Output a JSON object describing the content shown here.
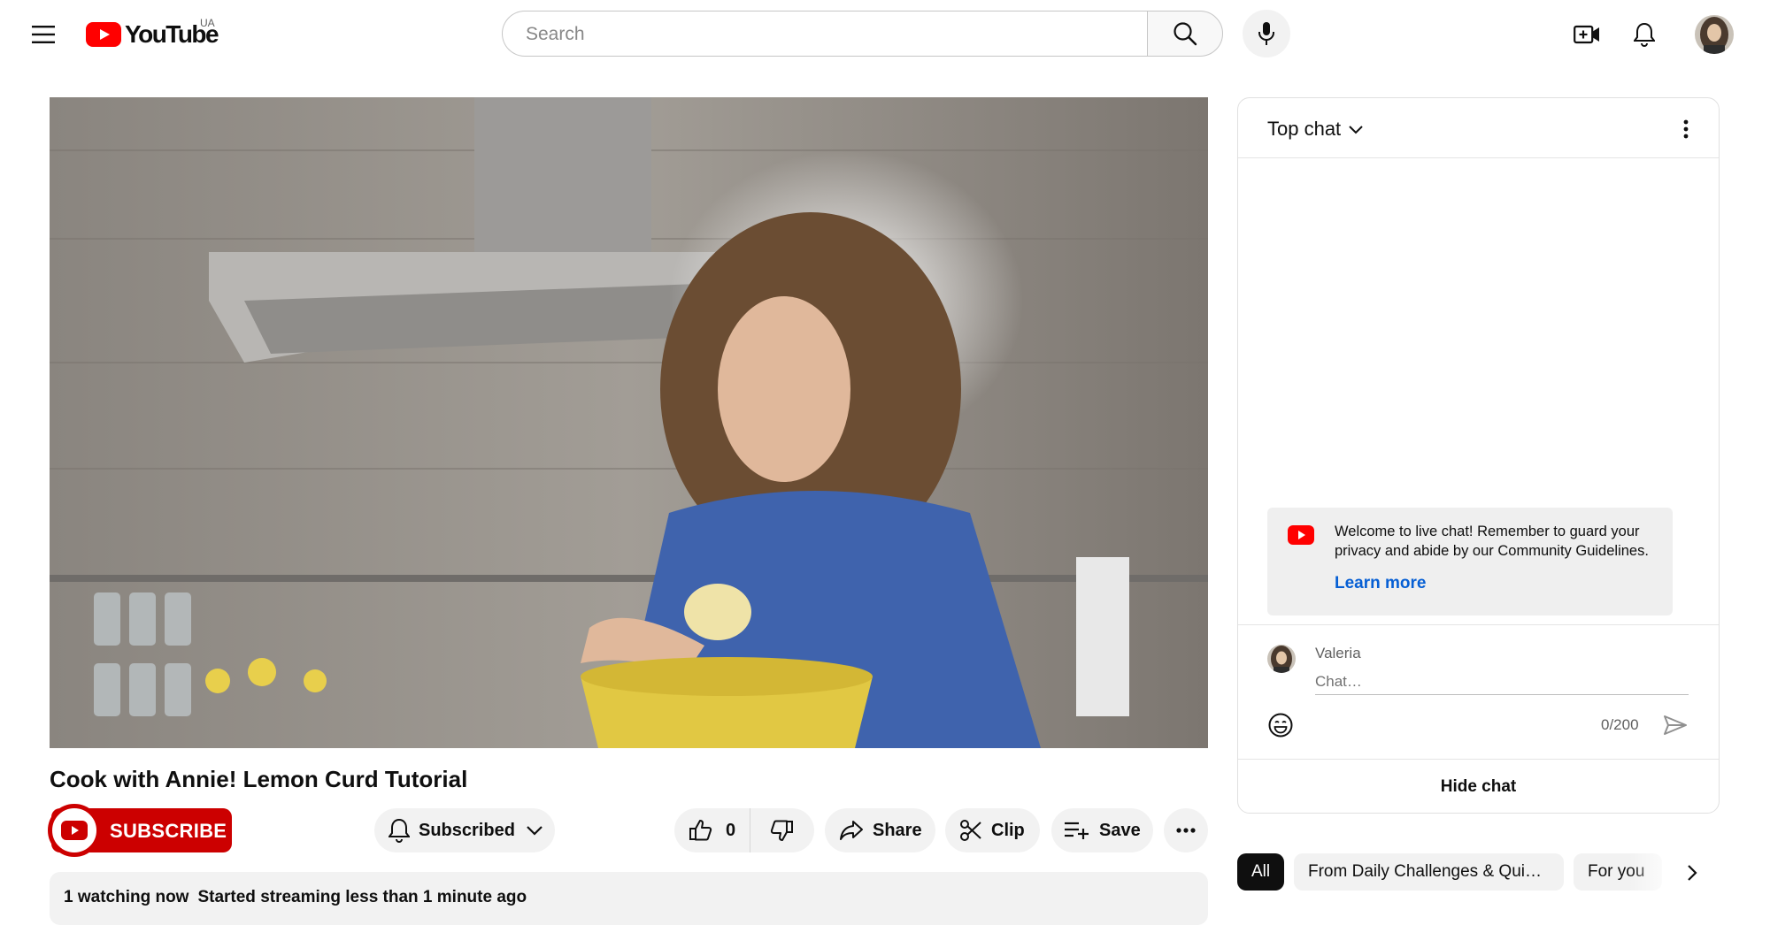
{
  "header": {
    "logo_text": "YouTube",
    "country_code": "UA",
    "search_placeholder": "Search"
  },
  "video": {
    "title": "Cook with Annie! Lemon Curd Tutorial",
    "watching": "1 watching now",
    "started": "Started streaming less than 1 minute ago"
  },
  "actions": {
    "subscribe_label": "SUBSCRIBE",
    "subscribed_label": "Subscribed",
    "like_count": "0",
    "share_label": "Share",
    "clip_label": "Clip",
    "save_label": "Save"
  },
  "chat": {
    "title": "Top chat",
    "welcome_text": "Welcome to live chat! Remember to guard your privacy and abide by our Community Guidelines.",
    "learn_more": "Learn more",
    "user_name": "Valeria",
    "input_placeholder": "Chat…",
    "char_count": "0/200",
    "hide_chat": "Hide chat"
  },
  "chips": {
    "all": "All",
    "daily": "From Daily Challenges & Quizz…",
    "for_you": "For you"
  },
  "colors": {
    "brand_red": "#ff0000",
    "subscribe_red": "#cc0000",
    "link_blue": "#065fd4"
  }
}
